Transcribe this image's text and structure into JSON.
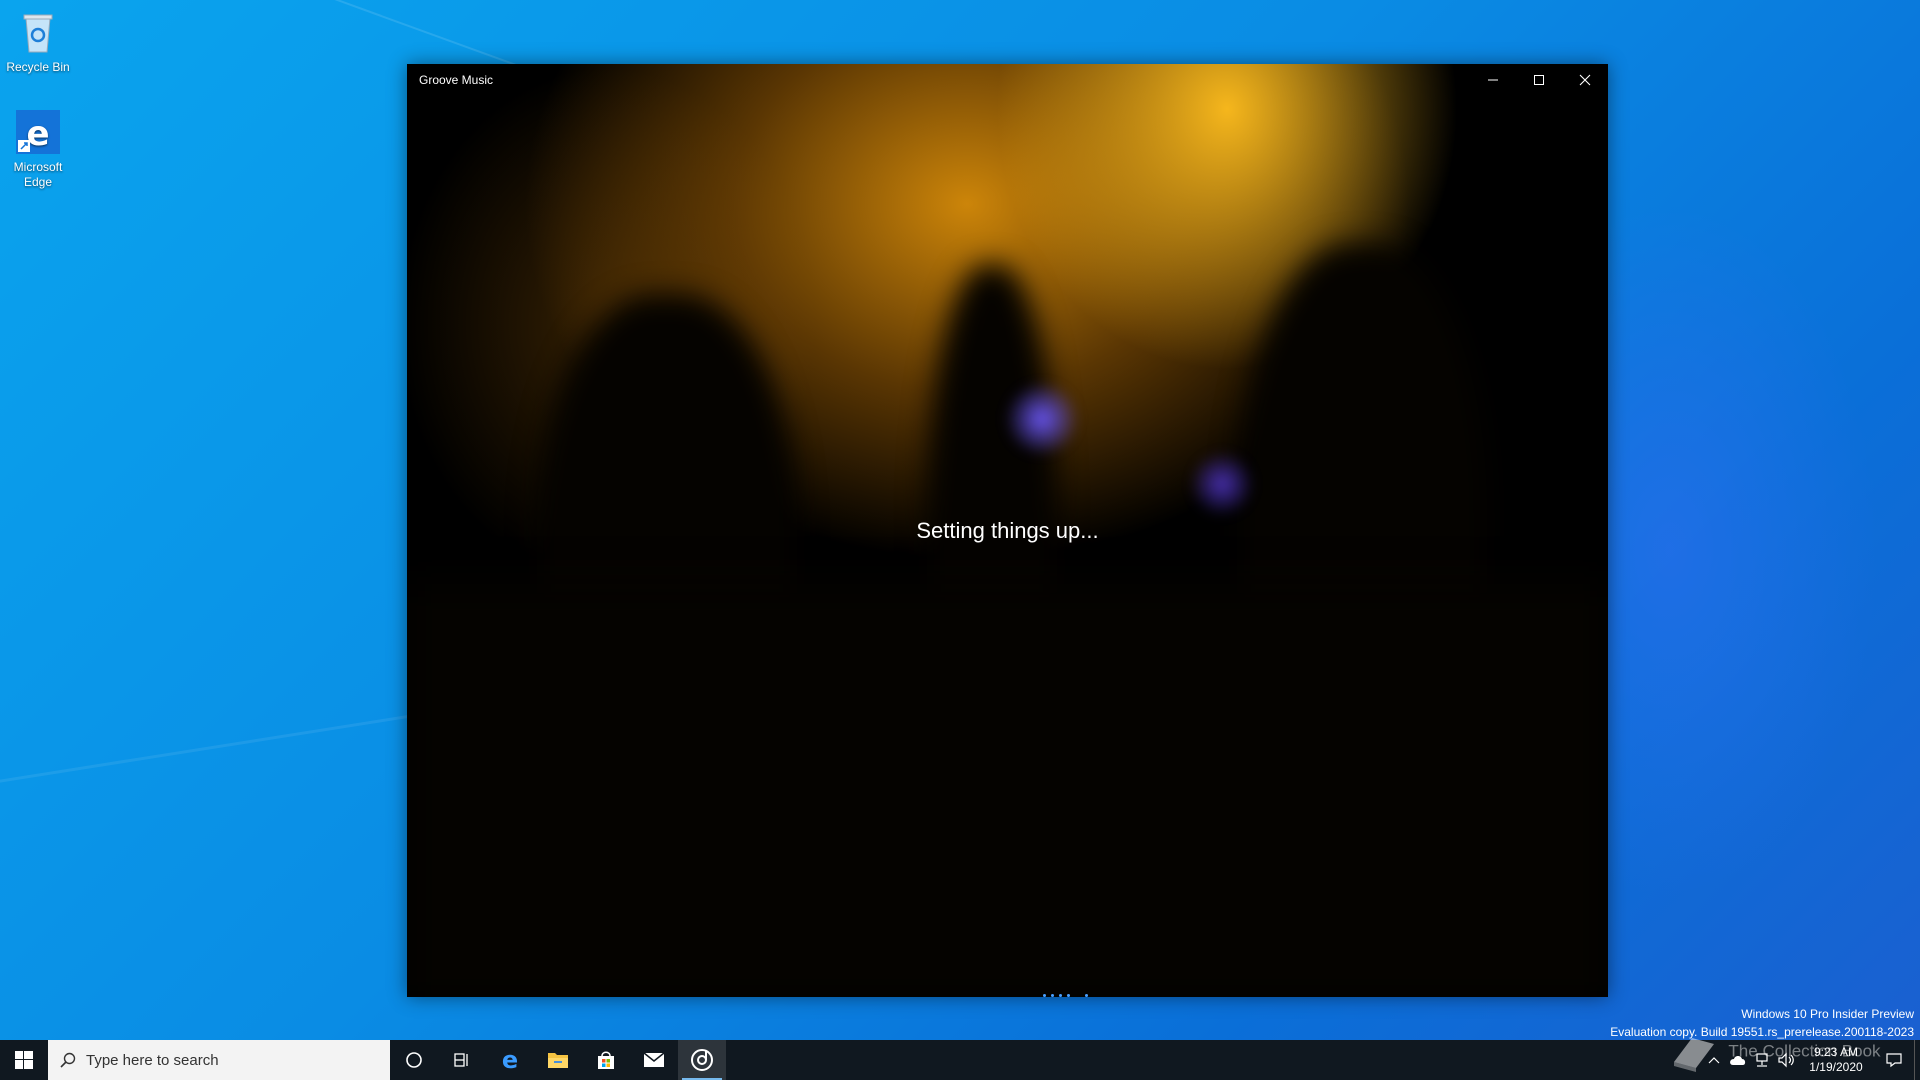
{
  "desktop": {
    "icons": [
      {
        "label": "Recycle Bin"
      },
      {
        "label": "Microsoft\nEdge"
      }
    ]
  },
  "window": {
    "title": "Groove Music",
    "status_text": "Setting things up..."
  },
  "watermark": {
    "line1": "Windows 10 Pro Insider Preview",
    "line2": "Evaluation copy. Build 19551.rs_prerelease.200118-2023"
  },
  "taskbar": {
    "search_placeholder": "Type here to search",
    "pinned": [
      "cortana-icon",
      "task-view-icon",
      "edge-icon",
      "file-explorer-icon",
      "store-icon",
      "mail-icon",
      "groove-music-icon"
    ],
    "clock_time": "9:23 AM",
    "clock_date": "1/19/2020"
  },
  "overlay_text": "The Collection Book",
  "colors": {
    "accent": "#76b9ed",
    "taskbar": "#101820",
    "desktop": "#0a8ce4"
  }
}
